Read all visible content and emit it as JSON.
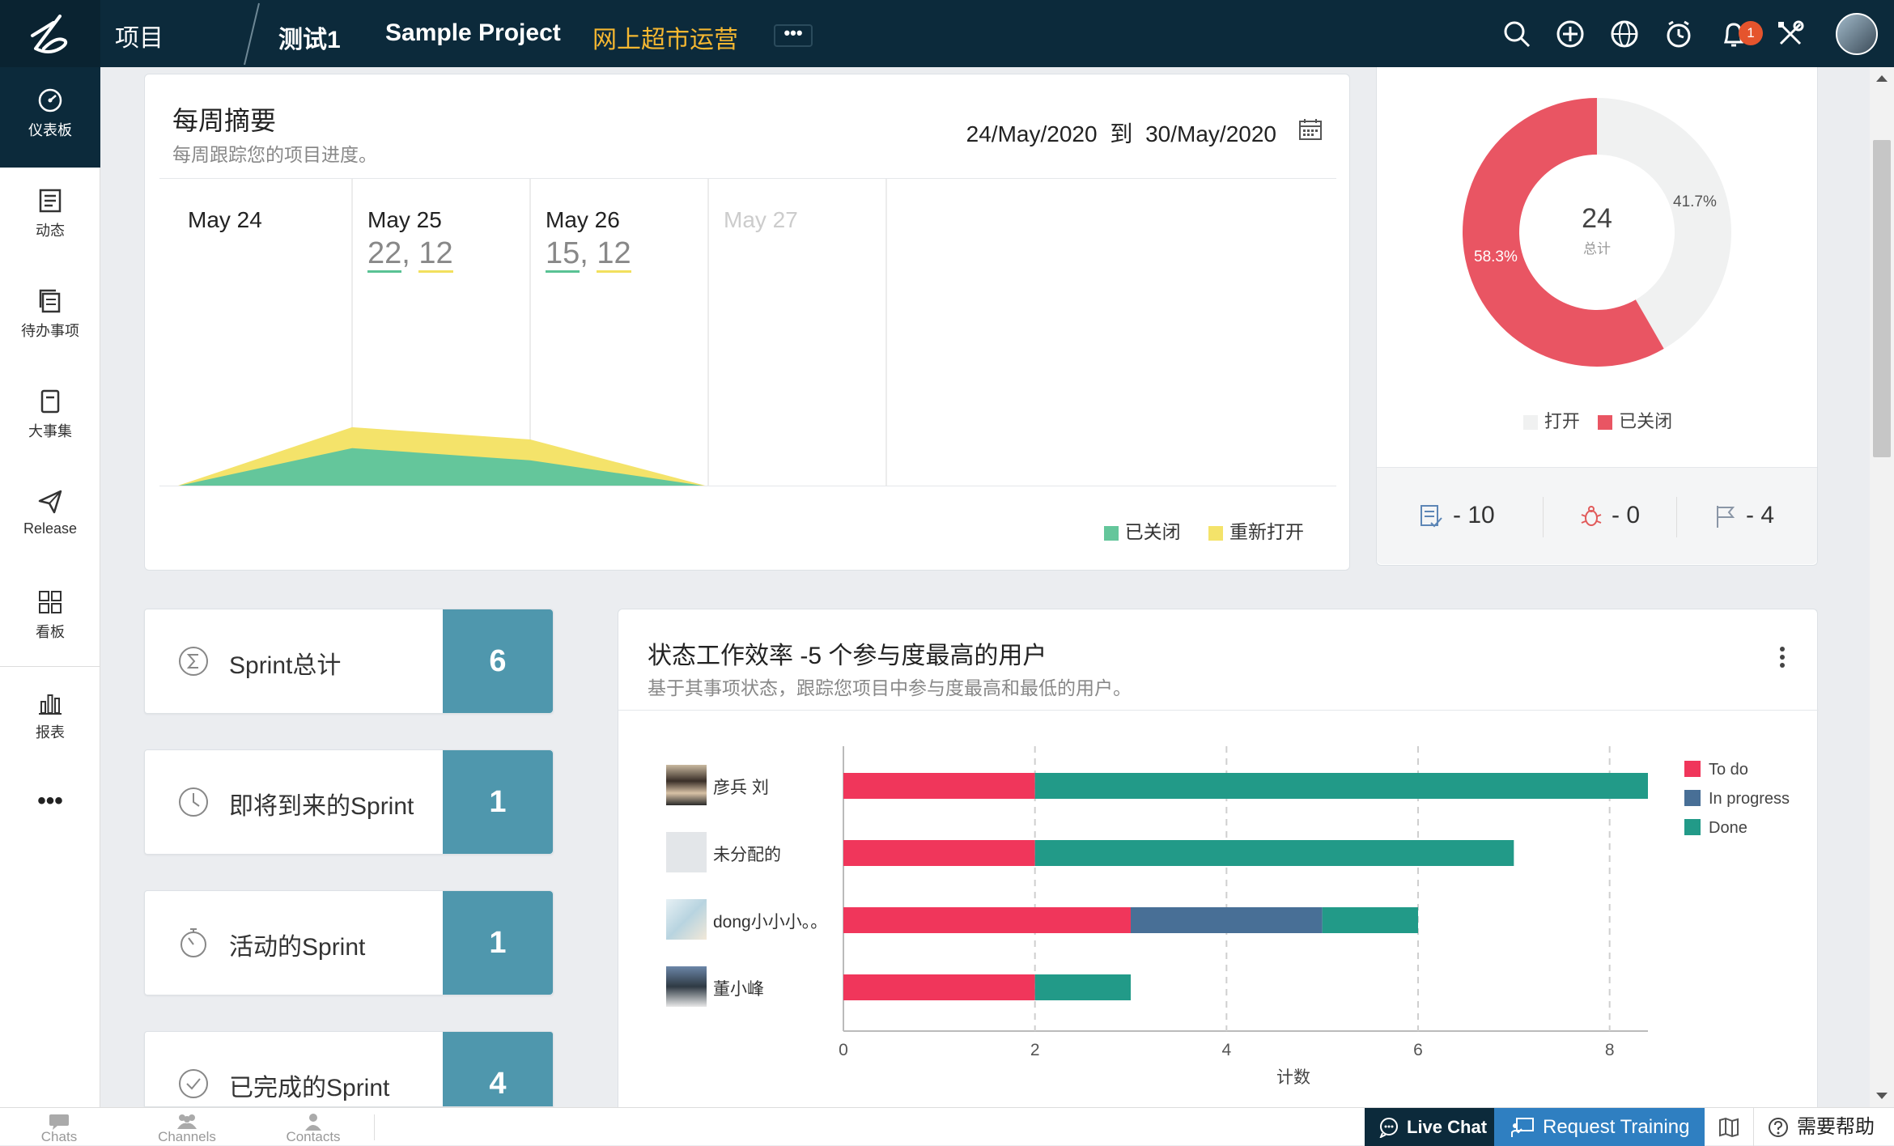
{
  "topbar": {
    "projects_label": "项目",
    "tabs": [
      {
        "label": "测试1"
      },
      {
        "label": "Sample Project"
      },
      {
        "label": "网上超市运营"
      }
    ],
    "more_label": "•••",
    "notification_count": "1"
  },
  "sidebar": {
    "items": [
      {
        "label": "仪表板",
        "icon": "dashboard-icon"
      },
      {
        "label": "动态",
        "icon": "feed-icon"
      },
      {
        "label": "待办事项",
        "icon": "backlog-icon"
      },
      {
        "label": "大事集",
        "icon": "epic-icon"
      },
      {
        "label": "Release",
        "icon": "release-icon"
      },
      {
        "label": "看板",
        "icon": "board-icon"
      },
      {
        "label": "报表",
        "icon": "report-icon"
      }
    ],
    "more_label": "•••"
  },
  "weekly": {
    "title": "每周摘要",
    "subtitle": "每周跟踪您的项目进度。",
    "range_start": "24/May/2020",
    "range_sep": "到",
    "range_end": "30/May/2020",
    "days": [
      {
        "label": "May 24",
        "closed": "",
        "reopened": ""
      },
      {
        "label": "May 25",
        "closed": "22",
        "reopened": "12"
      },
      {
        "label": "May 26",
        "closed": "15",
        "reopened": "12"
      },
      {
        "label": "May 27",
        "closed": "",
        "reopened": ""
      }
    ],
    "legend_closed": "已关闭",
    "legend_reopened": "重新打开"
  },
  "donut": {
    "total": "24",
    "total_label": "总计",
    "open_pct": "41.7%",
    "closed_pct": "58.3%",
    "legend_open": "打开",
    "legend_closed": "已关闭",
    "counts": [
      {
        "icon": "task-icon",
        "value": "- 10"
      },
      {
        "icon": "bug-icon",
        "value": "- 0"
      },
      {
        "icon": "milestone-flag-icon",
        "value": "- 4"
      }
    ]
  },
  "sprints": [
    {
      "label": "Sprint总计",
      "value": "6",
      "icon": "sigma-icon"
    },
    {
      "label": "即将到来的Sprint",
      "value": "1",
      "icon": "clock-icon"
    },
    {
      "label": "活动的Sprint",
      "value": "1",
      "icon": "timer-icon"
    },
    {
      "label": "已完成的Sprint",
      "value": "4",
      "icon": "check-circle-icon"
    }
  ],
  "users_chart": {
    "title": "状态工作效率 -5 个参与度最高的用户",
    "subtitle": "基于其事项状态，跟踪您项目中参与度最高和最低的用户。"
  },
  "chart_data": {
    "type": "bar",
    "orientation": "horizontal",
    "stacked": true,
    "categories": [
      "彦兵 刘",
      "未分配的",
      "dong小小小。。",
      "董小峰"
    ],
    "series": [
      {
        "name": "To do",
        "color": "#f0365b",
        "values": [
          2,
          2,
          3,
          2
        ]
      },
      {
        "name": "In progress",
        "color": "#486f96",
        "values": [
          0,
          0,
          2,
          0
        ]
      },
      {
        "name": "Done",
        "color": "#229a88",
        "values": [
          6.4,
          5,
          1,
          1
        ]
      }
    ],
    "xlim": [
      0,
      8.4
    ],
    "xticks": [
      "0",
      "2",
      "4",
      "6",
      "8"
    ],
    "xlabel": "计数",
    "grid": true,
    "legend": "right"
  },
  "bottombar": {
    "chats": "Chats",
    "channels": "Channels",
    "contacts": "Contacts",
    "live_chat": "Live Chat",
    "request_training": "Request Training",
    "help": "需要帮助"
  }
}
